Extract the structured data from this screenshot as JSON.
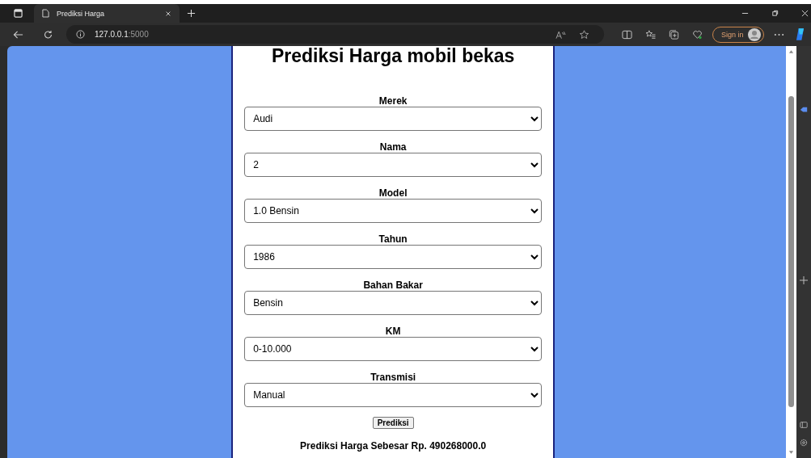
{
  "browser": {
    "tabs": [
      {
        "title": "Prediksi Harga",
        "selected": true
      }
    ],
    "address": {
      "host": "127.0.0.1",
      "port": ":5000"
    },
    "sign_in": "Sign in"
  },
  "page": {
    "title": "Prediksi Harga mobil bekas",
    "fields": [
      {
        "label": "Merek",
        "value": "Audi"
      },
      {
        "label": "Nama",
        "value": "2"
      },
      {
        "label": "Model",
        "value": "1.0 Bensin"
      },
      {
        "label": "Tahun",
        "value": "1986"
      },
      {
        "label": "Bahan Bakar",
        "value": "Bensin"
      },
      {
        "label": "KM",
        "value": "0-10.000"
      },
      {
        "label": "Transmisi",
        "value": "Manual"
      }
    ],
    "submit": "Prediksi",
    "result": "Prediksi Harga Sebesar Rp. 490268000.0"
  }
}
